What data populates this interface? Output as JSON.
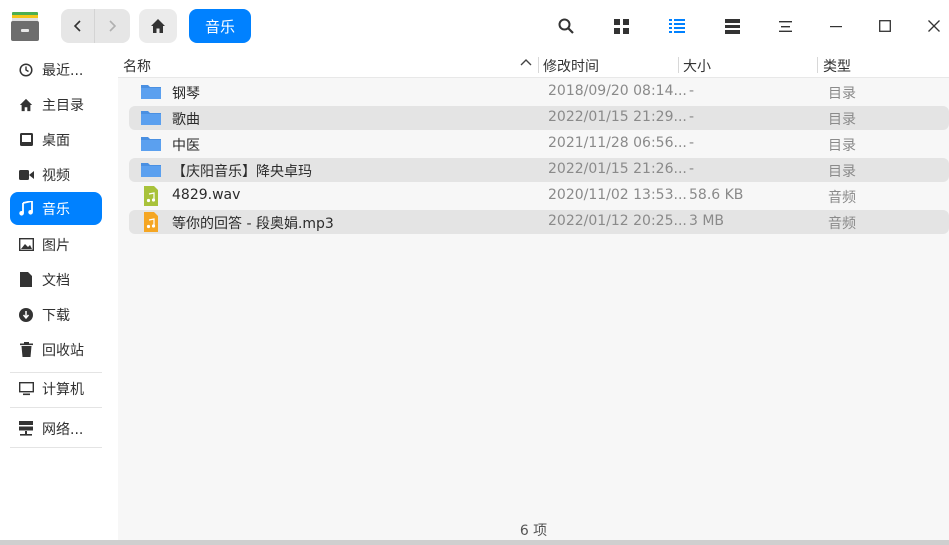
{
  "titlebar": {
    "breadcrumb": "音乐"
  },
  "sidebar": {
    "items": [
      {
        "label": "最近...",
        "icon": "clock-icon"
      },
      {
        "label": "主目录",
        "icon": "home-icon"
      },
      {
        "label": "桌面",
        "icon": "desktop-icon"
      },
      {
        "label": "视频",
        "icon": "video-icon"
      },
      {
        "label": "音乐",
        "icon": "music-icon",
        "active": true
      },
      {
        "label": "图片",
        "icon": "image-icon"
      },
      {
        "label": "文档",
        "icon": "document-icon"
      },
      {
        "label": "下载",
        "icon": "download-icon"
      },
      {
        "label": "回收站",
        "icon": "trash-icon"
      },
      {
        "label": "计算机",
        "icon": "computer-icon"
      },
      {
        "label": "网络...",
        "icon": "network-icon"
      }
    ]
  },
  "table": {
    "columns": [
      "名称",
      "修改时间",
      "大小",
      "类型"
    ],
    "rows": [
      {
        "name": "钢琴",
        "time": "2018/09/20 08:14...",
        "size": "-",
        "type": "目录",
        "icon": "folder-icon"
      },
      {
        "name": "歌曲",
        "time": "2022/01/15 21:29...",
        "size": "-",
        "type": "目录",
        "icon": "folder-icon"
      },
      {
        "name": "中医",
        "time": "2021/11/28 06:56...",
        "size": "-",
        "type": "目录",
        "icon": "folder-icon"
      },
      {
        "name": "【庆阳音乐】降央卓玛",
        "time": "2022/01/15 21:26...",
        "size": "-",
        "type": "目录",
        "icon": "folder-icon"
      },
      {
        "name": "4829.wav",
        "time": "2020/11/02 13:53...",
        "size": "58.6 KB",
        "type": "音频",
        "icon": "audio-wav-icon"
      },
      {
        "name": "等你的回答 - 段奥娟.mp3",
        "time": "2022/01/12 20:25...",
        "size": "3 MB",
        "type": "音频",
        "icon": "audio-mp3-icon"
      }
    ]
  },
  "status": "6 项",
  "colors": {
    "accent": "#0081ff",
    "folder": "#4a90e2",
    "wav": "#a8c23a",
    "mp3": "#f5a623"
  }
}
